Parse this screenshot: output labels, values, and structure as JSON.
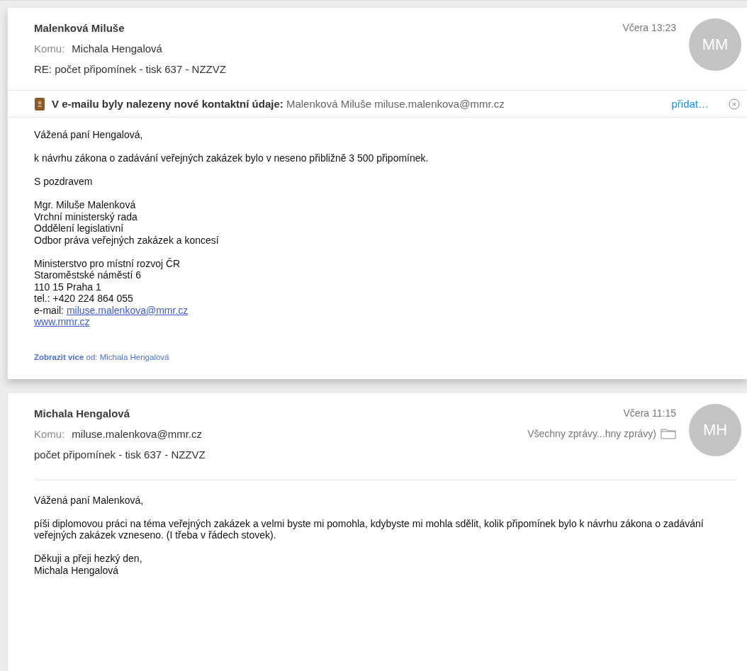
{
  "messages": [
    {
      "sender": "Malenková Miluše",
      "date": "Včera 13:23",
      "to_label": "Komu:",
      "to": "Michala Hengalová",
      "subject": "RE: počet připomínek - tisk 637 - NZZVZ",
      "initials": "MM",
      "expanded": true,
      "contact_banner": {
        "label": "V e-mailu byly nalezeny nové kontaktní údaje:",
        "contact": "Malenková Miluše miluse.malenkova@mmr.cz",
        "action": "přidat…"
      },
      "paragraphs": [
        [
          {
            "kind": "text",
            "text": "Vážená paní Hengalová,"
          }
        ],
        [
          {
            "kind": "text",
            "text": "k návrhu zákona o zadávání veřejných zakázek bylo v neseno přibližně  3 500 připomínek."
          }
        ],
        [
          {
            "kind": "text",
            "text": "S pozdravem"
          }
        ],
        [
          {
            "kind": "text",
            "text": "Mgr. Miluše Malenková"
          },
          {
            "kind": "text",
            "text": "Vrchní ministerský rada"
          },
          {
            "kind": "text",
            "text": "Oddělení legislativní"
          },
          {
            "kind": "text",
            "text": "Odbor práva veřejných zakázek a koncesí"
          }
        ],
        [
          {
            "kind": "text",
            "text": "Ministerstvo pro místní rozvoj ČR"
          },
          {
            "kind": "text",
            "text": "Staroměstské náměstí 6"
          },
          {
            "kind": "text",
            "text": "110 15 Praha 1"
          },
          {
            "kind": "text",
            "text": "tel.: +420 224 864 055"
          },
          {
            "kind": "prefixed_link",
            "prefix": "e-mail:",
            "text": "miluse.malenkova@mmr.cz"
          },
          {
            "kind": "link",
            "text": "www.mmr.cz"
          }
        ]
      ],
      "show_more": "**Zobrazit více** od: Michala Hengalová"
    },
    {
      "sender": "Michala Hengalová",
      "date": "Včera 11:15",
      "to_label": "Komu:",
      "to": "miluse.malenkova@mmr.cz",
      "subject": "počet připomínek - tisk 637 - NZZVZ",
      "initials": "MH",
      "expanded": false,
      "mailbox": "Všechny zprávy...hny zprávy)",
      "paragraphs": [
        [
          {
            "kind": "text",
            "text": "Vážená paní Malenková,"
          }
        ],
        [
          {
            "kind": "text",
            "text": "píši diplomovou práci na téma veřejných zakázek a velmi byste mi pomohla, kdybyste mi mohla sdělit, kolik připomínek bylo k návrhu zákona o zadávání veřejných zakázek vzneseno. (I třeba v řádech stovek)."
          }
        ],
        [
          {
            "kind": "text",
            "text": "Děkuji a přeji hezký den,"
          },
          {
            "kind": "text",
            "text": "Michala Hengalová"
          }
        ]
      ]
    }
  ]
}
